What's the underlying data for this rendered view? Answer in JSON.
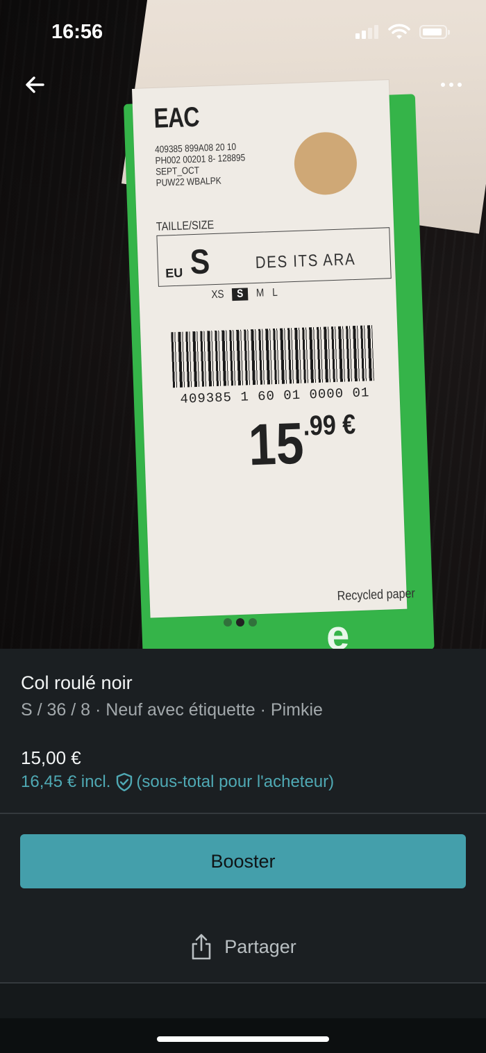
{
  "status_bar": {
    "time": "16:56"
  },
  "nav": {
    "back_icon": "arrow-left-icon",
    "more_icon": "more-dots-icon"
  },
  "photo": {
    "carousel": {
      "total": 3,
      "active_index": 1
    },
    "tag": {
      "logo": "EAC",
      "codes": [
        "409385 899A08 20 10",
        "PH002 00201  8- 128895",
        "SEPT_OCT",
        "PUW22 WBALPK"
      ],
      "size_title": "TAILLE/SIZE",
      "eu_label": "EU",
      "size": "S",
      "other_sizes": "DES  ITS  ARA",
      "size_scale": [
        "XS",
        "S",
        "M",
        "L"
      ],
      "barcode_number": "409385 1 60 01 0000 01",
      "price_int": "15",
      "price_dec": ".99 €",
      "recycled": "Recycled paper"
    }
  },
  "item": {
    "title": "Col roulé noir",
    "subtitle": "S / 36 / 8 · Neuf avec étiquette · Pimkie",
    "price": "15,00 €",
    "buyer_price": "16,45 € incl.",
    "buyer_note": "(sous-total pour l'acheteur)"
  },
  "actions": {
    "booster_label": "Booster",
    "share_label": "Partager"
  },
  "colors": {
    "accent": "#449fab",
    "link": "#4fa9b4",
    "background": "#1b1f22"
  }
}
